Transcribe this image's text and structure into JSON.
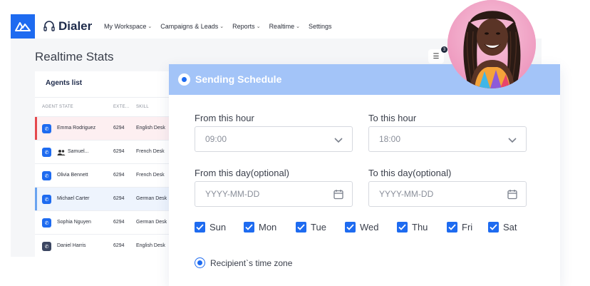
{
  "app": {
    "brand": "Dialer",
    "nav": [
      {
        "label": "My Workspace"
      },
      {
        "label": "Campaigns & Leads"
      },
      {
        "label": "Reports"
      },
      {
        "label": "Realtime"
      },
      {
        "label": "Settings"
      }
    ],
    "page_title": "Realtime Stats",
    "filter_badge": "3"
  },
  "agents": {
    "title": "Agents list",
    "columns": [
      "AGENT STATE",
      "EXTE...",
      "SKILL"
    ],
    "rows": [
      {
        "name": "Emma Rodriguez",
        "ext": "6294",
        "skill": "English Desk",
        "state": "alert"
      },
      {
        "name": "Samuel...",
        "ext": "6294",
        "skill": "French Desk",
        "state": "group"
      },
      {
        "name": "Olivia Bennett",
        "ext": "6294",
        "skill": "French Desk",
        "state": "normal"
      },
      {
        "name": "Michael Carter",
        "ext": "6294",
        "skill": "German Desk",
        "state": "active"
      },
      {
        "name": "Sophia Nguyen",
        "ext": "6294",
        "skill": "German Desk",
        "state": "normal"
      },
      {
        "name": "Daniel Harris",
        "ext": "6294",
        "skill": "English Desk",
        "state": "offline"
      }
    ]
  },
  "schedule": {
    "title": "Sending Schedule",
    "from_hour_label": "From this hour",
    "from_hour_value": "09:00",
    "to_hour_label": "To this hour",
    "to_hour_value": "18:00",
    "from_day_label": "From this day(optional)",
    "from_day_placeholder": "YYYY-MM-DD",
    "to_day_label": "To this day(optional)",
    "to_day_placeholder": "YYYY-MM-DD",
    "days": [
      {
        "label": "Sun",
        "checked": true
      },
      {
        "label": "Mon",
        "checked": true
      },
      {
        "label": "Tue",
        "checked": true
      },
      {
        "label": "Wed",
        "checked": true
      },
      {
        "label": "Thu",
        "checked": true
      },
      {
        "label": "Fri",
        "checked": true
      },
      {
        "label": "Sat",
        "checked": true
      }
    ],
    "timezone_label": "Recipient`s time zone",
    "timezone_selected": true
  },
  "colors": {
    "accent": "#1e6bf0",
    "header_bg": "#a3c4f8",
    "alert_row": "#fdeff1",
    "active_row": "#eef4fd"
  }
}
